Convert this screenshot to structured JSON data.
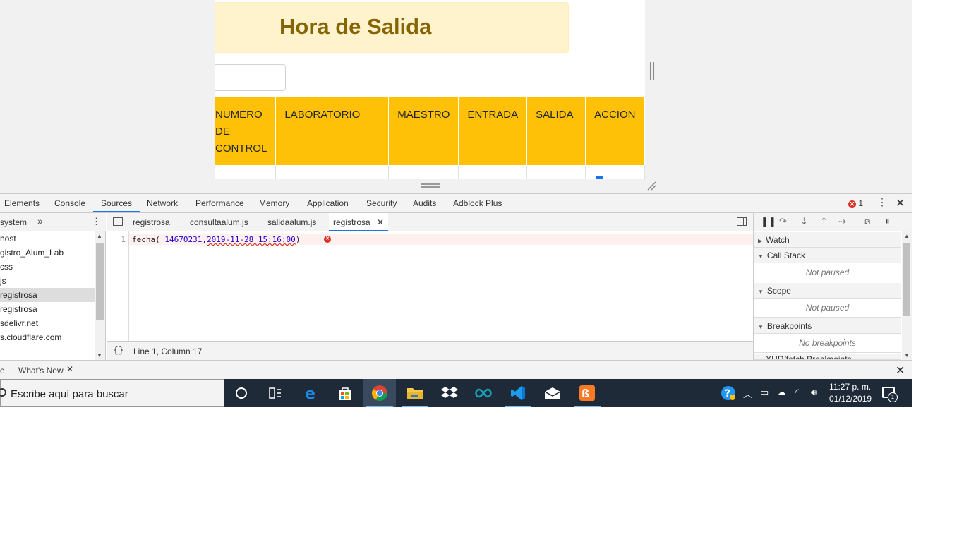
{
  "page": {
    "heading": "Hora de Salida",
    "table_headers": [
      "NUMERO DE CONTROL",
      "LABORATORIO",
      "MAESTRO",
      "ENTRADA",
      "SALIDA",
      "ACCION"
    ]
  },
  "devtools": {
    "tabs": [
      "Elements",
      "Console",
      "Sources",
      "Network",
      "Performance",
      "Memory",
      "Application",
      "Security",
      "Audits",
      "Adblock Plus"
    ],
    "active_tab": "Sources",
    "error_count": "1",
    "navigator": {
      "header": "system",
      "items": [
        "host",
        "gistro_Alum_Lab",
        "css",
        "js",
        "registrosa",
        "registrosa",
        "sdelivr.net",
        "s.cloudflare.com"
      ],
      "selected_index": 4
    },
    "editor": {
      "tabs": [
        "registrosa",
        "consultaalum.js",
        "salidaalum.js",
        "registrosa"
      ],
      "active_tab_index": 3,
      "line_number": "1",
      "code_prefix": "fecha( ",
      "code_value_1": "14670231",
      "code_sep": ",",
      "code_value_2": "2019-11-28 15:16:00",
      "code_suffix": ")",
      "cursor_position": "Line 1, Column 17",
      "pretty_print": "{}"
    },
    "debugger": {
      "sections": [
        {
          "title": "Watch"
        },
        {
          "title": "Call Stack",
          "empty": "Not paused"
        },
        {
          "title": "Scope",
          "empty": "Not paused"
        },
        {
          "title": "Breakpoints",
          "empty": "No breakpoints"
        },
        {
          "title": "XHR/fetch Breakpoints"
        }
      ]
    },
    "drawer": {
      "prev_tab": "e",
      "tab": "What's New"
    }
  },
  "taskbar": {
    "search_placeholder": "Escribe aquí para buscar",
    "apps": [
      "cortana-icon",
      "task-view-icon",
      "edge-icon",
      "store-icon",
      "chrome-icon",
      "file-explorer-icon",
      "dropbox-icon",
      "arduino-icon",
      "vscode-icon",
      "mail-icon",
      "xampp-icon"
    ],
    "time": "11:27 p. m.",
    "date": "01/12/2019",
    "notifications": "1"
  },
  "colors": {
    "table_header": "#ffc107",
    "alert_bg": "#fff3cd",
    "alert_text": "#856404",
    "devtools_accent": "#1a73e8",
    "error_red": "#d93025",
    "taskbar_bg": "#1f2a38"
  }
}
